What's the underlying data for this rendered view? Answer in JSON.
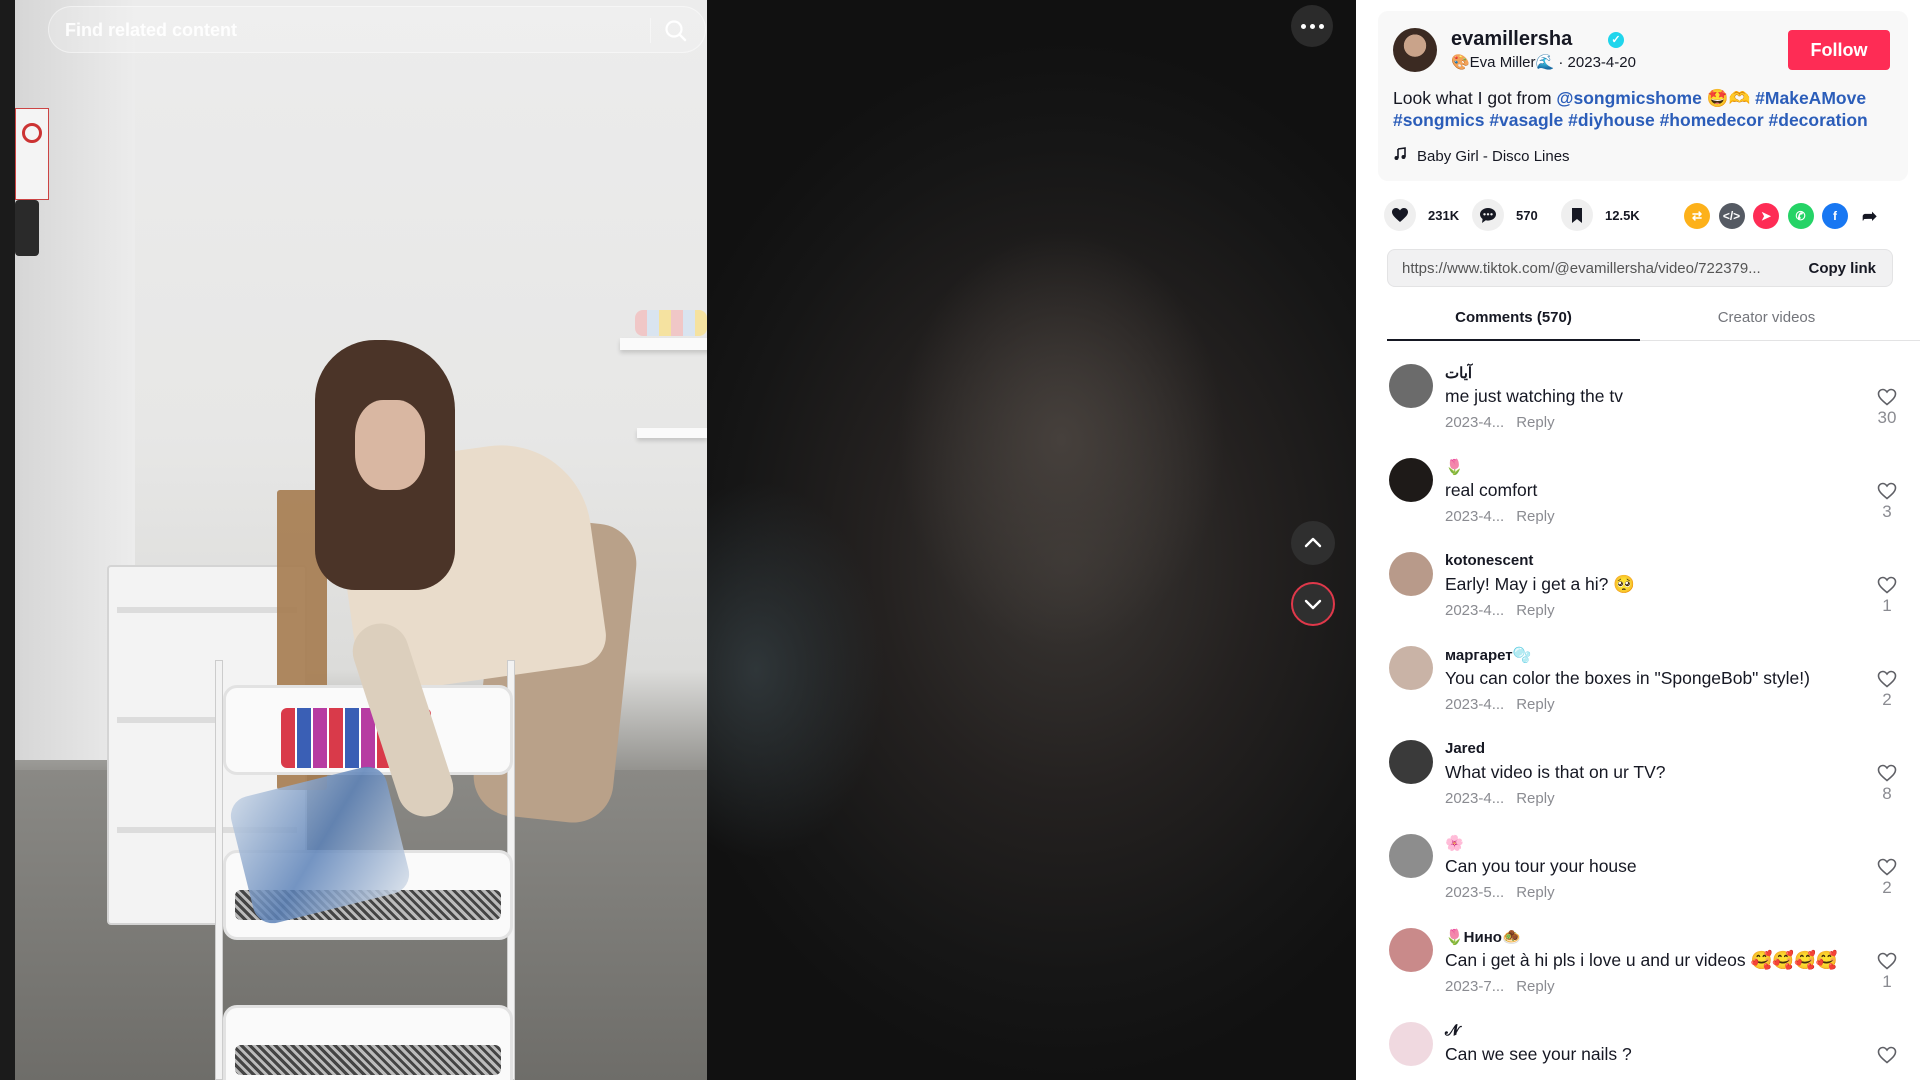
{
  "search": {
    "placeholder": "Find related content"
  },
  "post": {
    "username": "evamillersha",
    "display_name": "🎨Eva Miller🌊",
    "date": "2023-4-20",
    "follow_label": "Follow",
    "description_text": "Look what I got from ",
    "mention": "@songmicshome",
    "emoji": " 🤩🫶 ",
    "hashtags": [
      "#MakeAMove",
      "#songmics",
      "#vasagle",
      "#diyhouse",
      "#homedecor",
      "#decoration"
    ],
    "music": "Baby Girl - Disco Lines"
  },
  "stats": {
    "likes": "231K",
    "comments": "570",
    "saves": "12.5K"
  },
  "share_icons": [
    {
      "name": "repost-icon",
      "color": "#fdb11a",
      "glyph": "⇄"
    },
    {
      "name": "embed-icon",
      "color": "#555a63",
      "glyph": "</>"
    },
    {
      "name": "send-to-friends-icon",
      "color": "#fe2c55",
      "glyph": "➤"
    },
    {
      "name": "whatsapp-icon",
      "color": "#25d366",
      "glyph": "✆"
    },
    {
      "name": "facebook-icon",
      "color": "#1877f2",
      "glyph": "f"
    },
    {
      "name": "share-arrow-icon",
      "color": "#161823",
      "glyph": "➦"
    }
  ],
  "link": {
    "url": "https://www.tiktok.com/@evamillersha/video/722379...",
    "copy_label": "Copy link"
  },
  "tabs": {
    "comments_label": "Comments (570)",
    "creator_label": "Creator videos"
  },
  "comments": [
    {
      "name": "آيات",
      "text": "me just watching the tv",
      "date": "2023-4...",
      "reply": "Reply",
      "likes": "30",
      "avatar": "#6b6b6b"
    },
    {
      "name": "🌷",
      "text": "real comfort",
      "date": "2023-4...",
      "reply": "Reply",
      "likes": "3",
      "avatar": "#1e1a18"
    },
    {
      "name": "kotonescent",
      "text": "Early! May i get a hi? 🥺",
      "date": "2023-4...",
      "reply": "Reply",
      "likes": "1",
      "avatar": "#b89a8a"
    },
    {
      "name": "маргарет🫧",
      "text": "You can color the boxes in \"SpongeBob\" style!)",
      "date": "2023-4...",
      "reply": "Reply",
      "likes": "2",
      "avatar": "#c9b3a6"
    },
    {
      "name": "Jared",
      "text": "What video is that on ur TV?",
      "date": "2023-4...",
      "reply": "Reply",
      "likes": "8",
      "avatar": "#3a3a3a"
    },
    {
      "name": "🌸",
      "text": "Can you tour your house",
      "date": "2023-5...",
      "reply": "Reply",
      "likes": "2",
      "avatar": "#8d8d8d"
    },
    {
      "name": "🌷Нино🧆",
      "text": "Can i get à hi pls i love u and ur videos 🥰🥰🥰🥰",
      "date": "2023-7...",
      "reply": "Reply",
      "likes": "1",
      "avatar": "#c98a8a"
    },
    {
      "name": "𝓝",
      "text": "Can we see your nails ?",
      "date": "",
      "reply": "",
      "likes": "",
      "avatar": "#f0d9e0"
    }
  ]
}
